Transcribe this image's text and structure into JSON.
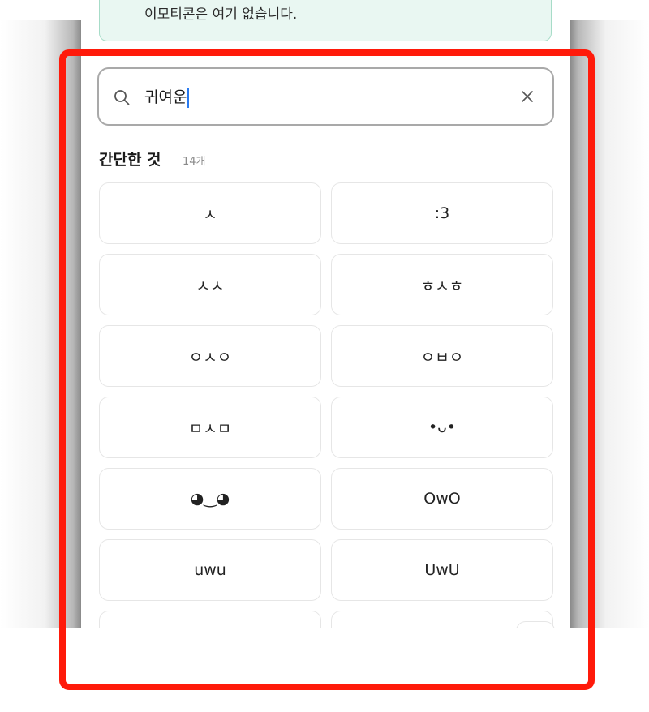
{
  "notice": {
    "text": "이모티콘은 여기 없습니다."
  },
  "search": {
    "value": "귀여운",
    "search_icon": "search-icon",
    "clear_icon": "close-icon"
  },
  "section": {
    "title": "간단한 것",
    "count": "14개"
  },
  "tiles": [
    "ㅅ",
    ":3",
    "ㅅㅅ",
    "ㅎㅅㅎ",
    "ㅇㅅㅇ",
    "ㅇㅂㅇ",
    "ㅁㅅㅁ",
    "•ᴗ•",
    "◕‿◕",
    "OwO",
    "uwu",
    "UwU",
    "",
    ""
  ],
  "colors": {
    "highlight": "#ff1a0a",
    "notice_bg": "#e9f7f2",
    "caret": "#2a7bf0"
  }
}
